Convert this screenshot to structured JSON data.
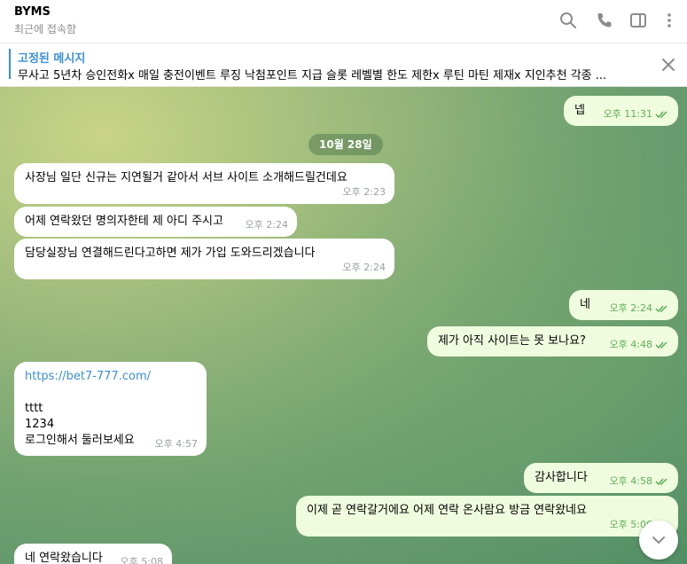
{
  "header": {
    "title": "BYMS",
    "status": "최근에 접속함"
  },
  "pinned": {
    "title": "고정된 메시지",
    "text": "무사고 5년차 승인전화x 매일 충전이벤트 루징 낙첨포인트 지급 슬롯 레벨별 한도 제한x 루틴 마틴 제재x  지인추천 각종 ..."
  },
  "messages": {
    "m0": {
      "text": "넵",
      "time": "오후 11:31"
    },
    "date": "10월 28일",
    "m1": {
      "text": "사장님 일단 신규는 지연될거 같아서  서브 사이트 소개해드릴건데요",
      "time": "오후 2:23"
    },
    "m2": {
      "text": "어제 연락왔던 명의자한테 제 아디 주시고",
      "time": "오후 2:24"
    },
    "m3": {
      "text": "담당실장님 연결해드린다고하면 제가 가입 도와드리겠습니다",
      "time": "오후 2:24"
    },
    "m4": {
      "text": "네",
      "time": "오후 2:24"
    },
    "m5": {
      "text": "제가 아직 사이트는 못 보나요?",
      "time": "오후 4:48"
    },
    "m6": {
      "link": "https://bet7-777.com/",
      "line1": "tttt",
      "line2": "1234",
      "line3": "로그인해서 둘러보세요",
      "time": "오후 4:57"
    },
    "m7": {
      "text": "감사합니다",
      "time": "오후 4:58"
    },
    "m8": {
      "text": "이제 곧 연락갈거에요 어제 연락 온사람요 방금 연락왔네요",
      "time": "오후 5:06"
    },
    "m9": {
      "text": "네 연락왔습니다",
      "time": "오후 5:08"
    }
  },
  "icons": {
    "search": "search-icon",
    "call": "phone-icon",
    "sidebar": "sidebar-toggle-icon",
    "more": "more-vertical-icon",
    "close": "close-icon",
    "scroll": "chevron-down-icon"
  },
  "colors": {
    "accent": "#3a8fd6",
    "outgoing_bubble": "#effdde",
    "read_ticks": "#5fae59"
  }
}
